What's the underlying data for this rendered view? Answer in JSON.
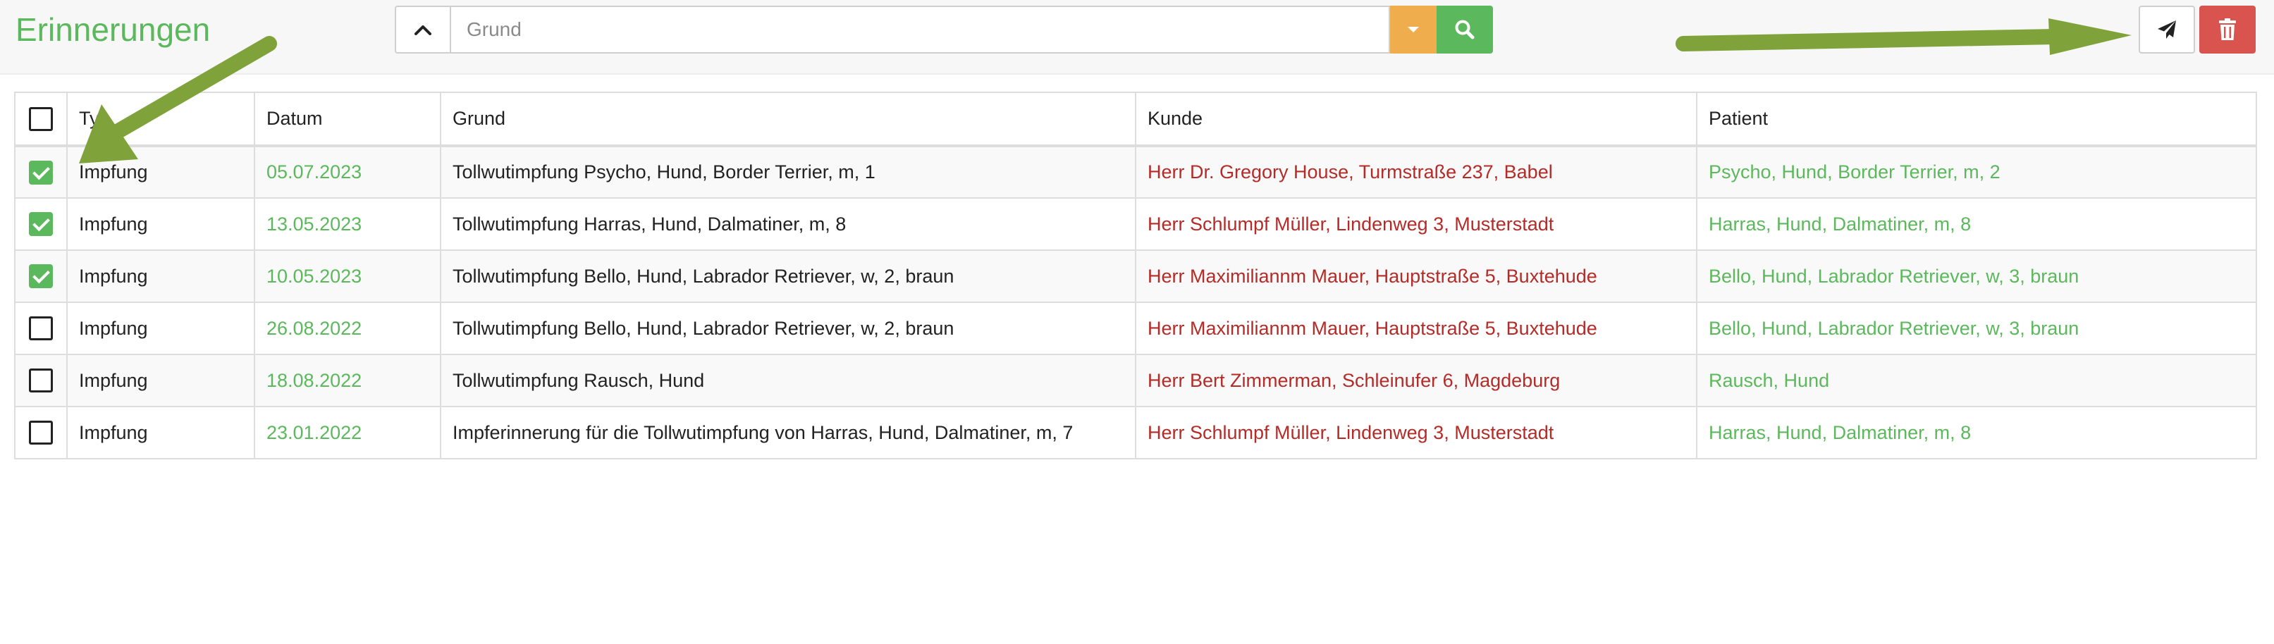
{
  "header": {
    "title": "Erinnerungen"
  },
  "search": {
    "placeholder": "Grund",
    "value": ""
  },
  "icons": {
    "collapse": "chevron-up-icon",
    "dropdown": "caret-down-icon",
    "search": "search-icon",
    "send": "paper-plane-icon",
    "delete": "trash-icon"
  },
  "colors": {
    "title": "#5cb85c",
    "date": "#5cb85c",
    "kunde": "#b52b27",
    "patient": "#5cb85c",
    "dropdown_button": "#f0ad4e",
    "search_button": "#5cb85c",
    "delete_button": "#d9534f",
    "annotation_arrow": "#7fa23a"
  },
  "table": {
    "columns": {
      "typ": "Typ",
      "datum": "Datum",
      "grund": "Grund",
      "kunde": "Kunde",
      "patient": "Patient"
    },
    "header_checked": false,
    "rows": [
      {
        "checked": true,
        "typ": "Impfung",
        "datum": "05.07.2023",
        "grund": "Tollwutimpfung Psycho, Hund, Border Terrier, m, 1",
        "kunde": "Herr Dr. Gregory House, Turmstraße 237, Babel",
        "patient": "Psycho, Hund, Border Terrier, m, 2"
      },
      {
        "checked": true,
        "typ": "Impfung",
        "datum": "13.05.2023",
        "grund": "Tollwutimpfung Harras, Hund, Dalmatiner, m, 8",
        "kunde": "Herr Schlumpf Müller, Lindenweg 3, Musterstadt",
        "patient": "Harras, Hund, Dalmatiner, m, 8"
      },
      {
        "checked": true,
        "typ": "Impfung",
        "datum": "10.05.2023",
        "grund": "Tollwutimpfung Bello, Hund, Labrador Retriever, w, 2, braun",
        "kunde": "Herr Maximiliannm Mauer, Hauptstraße 5, Buxtehude",
        "patient": "Bello, Hund, Labrador Retriever, w, 3, braun"
      },
      {
        "checked": false,
        "typ": "Impfung",
        "datum": "26.08.2022",
        "grund": "Tollwutimpfung Bello, Hund, Labrador Retriever, w, 2, braun",
        "kunde": "Herr Maximiliannm Mauer, Hauptstraße 5, Buxtehude",
        "patient": "Bello, Hund, Labrador Retriever, w, 3, braun"
      },
      {
        "checked": false,
        "typ": "Impfung",
        "datum": "18.08.2022",
        "grund": "Tollwutimpfung Rausch, Hund",
        "kunde": "Herr Bert Zimmerman, Schleinufer 6, Magdeburg",
        "patient": "Rausch, Hund"
      },
      {
        "checked": false,
        "typ": "Impfung",
        "datum": "23.01.2022",
        "grund": "Impferinnerung für die Tollwutimpfung von Harras, Hund, Dalmatiner, m, 7",
        "kunde": "Herr Schlumpf Müller, Lindenweg 3, Musterstadt",
        "patient": "Harras, Hund, Dalmatiner, m, 8"
      }
    ]
  }
}
